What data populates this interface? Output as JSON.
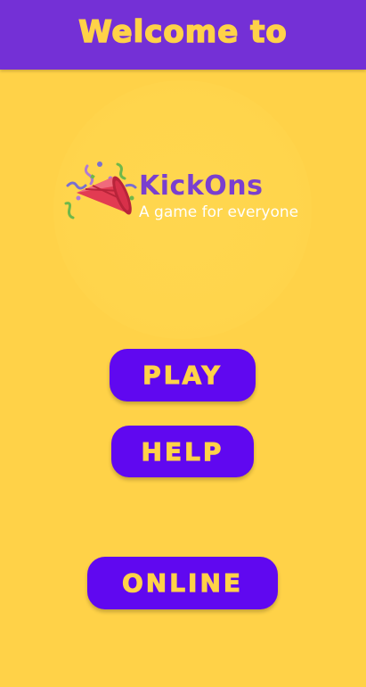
{
  "header": {
    "title": "Welcome to"
  },
  "logo": {
    "icon": "party-popper-icon",
    "name": "KickOns",
    "tagline": "A game for everyone"
  },
  "buttons": {
    "play": "PLAY",
    "help": "HELP",
    "online": "ONLINE"
  },
  "colors": {
    "background": "#ffd248",
    "header": "#7430d6",
    "button": "#6008f0",
    "accent_text": "#ffd248",
    "brand_text": "#7a3fcf"
  }
}
